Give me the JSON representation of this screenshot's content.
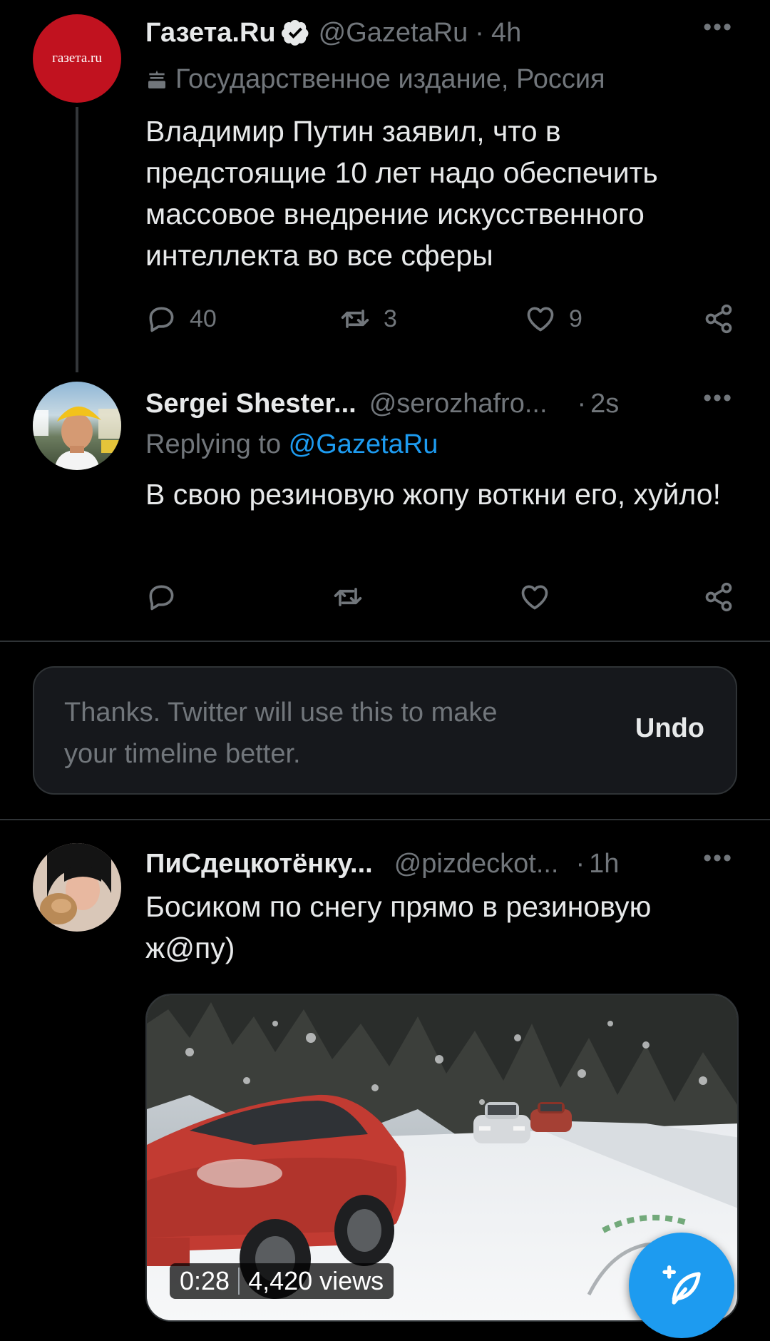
{
  "tweets": [
    {
      "name": "Газета.Ru",
      "handle": "@GazetaRu",
      "time": "4h",
      "dot": "·",
      "more": "•••",
      "avatar_text": "газета.ru",
      "label": "Государственное издание, Россия",
      "body": "Владимир Путин заявил, что в предстоящие 10 лет надо обеспечить массовое внедрение искусственного интеллекта во все сферы",
      "replies": "40",
      "retweets": "3",
      "likes": "9"
    },
    {
      "name": "Sergei Shester...",
      "handle": "@serozhafro...",
      "time": "2s",
      "dot": "·",
      "more": "•••",
      "replying_prefix": "Replying to ",
      "replying_to": "@GazetaRu",
      "body": "В свою резиновую жопу воткни его, хуйло!"
    },
    {
      "name": "ПиСдецкотёнку...",
      "handle": "@pizdeckot...",
      "time": "1h",
      "dot": "·",
      "more": "•••",
      "body": "Босиком по снегу прямо в резиновую ж@пу)",
      "video": {
        "duration": "0:28",
        "views": "4,420 views"
      }
    }
  ],
  "toast": {
    "message": "Thanks. Twitter will use this to make your timeline better.",
    "undo": "Undo"
  },
  "colors": {
    "background": "#000000",
    "text": "#e7e9ea",
    "muted": "#71767b",
    "link": "#1d9bf0",
    "verified": "#e7e9ea",
    "gazeta_red": "#c1121f"
  },
  "icons": [
    "verified-badge-icon",
    "government-building-icon",
    "reply-icon",
    "retweet-icon",
    "like-icon",
    "share-icon",
    "compose-tweet-icon"
  ]
}
